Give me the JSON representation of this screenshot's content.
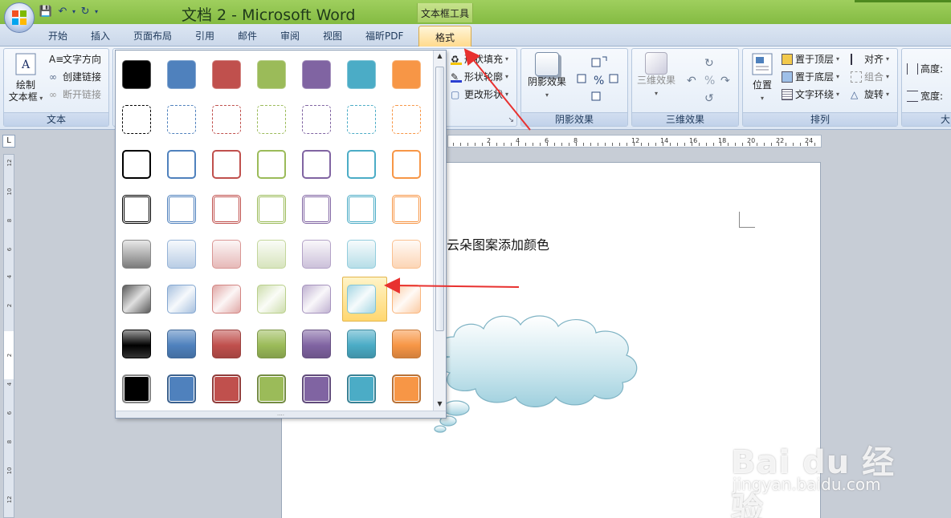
{
  "window": {
    "title": "文档 2 - Microsoft Word",
    "context_tab_group": "文本框工具"
  },
  "tabs": [
    {
      "label": "开始"
    },
    {
      "label": "插入"
    },
    {
      "label": "页面布局"
    },
    {
      "label": "引用"
    },
    {
      "label": "邮件"
    },
    {
      "label": "审阅"
    },
    {
      "label": "视图"
    },
    {
      "label": "福昕PDF"
    },
    {
      "label": "格式",
      "active": true
    }
  ],
  "ribbon": {
    "text_group": {
      "label": "文本",
      "draw_textbox_line1": "绘制",
      "draw_textbox_line2": "文本框",
      "text_direction": "文字方向",
      "create_link": "创建链接",
      "break_link": "断开链接"
    },
    "styles_group": {
      "shape_fill": "形状填充",
      "shape_outline": "形状轮廓",
      "change_shape": "更改形状"
    },
    "shadow_group": {
      "label": "阴影效果",
      "shadow_button": "阴影效果"
    },
    "threed_group": {
      "label": "三维效果",
      "threed_button": "三维效果"
    },
    "arrange_group": {
      "label": "排列",
      "position": "位置",
      "bring_front": "置于顶层",
      "send_back": "置于底层",
      "text_wrap": "文字环绕",
      "align": "对齐",
      "group": "组合",
      "rotate": "旋转"
    },
    "size_group": {
      "label": "大",
      "height": "高度:",
      "width": "宽度:"
    }
  },
  "document": {
    "body_text": "云朵图案添加颜色"
  },
  "ruler": {
    "horizontal_numbers": [
      "2",
      "4",
      "6",
      "8",
      "12",
      "14",
      "16",
      "18",
      "20",
      "22",
      "24"
    ],
    "vertical_numbers": [
      "12",
      "10",
      "8",
      "6",
      "4",
      "2",
      "2",
      "4",
      "6",
      "8",
      "10",
      "12"
    ]
  },
  "gallery": {
    "palette": [
      "#000000",
      "#4f81bd",
      "#c0504d",
      "#9bbb59",
      "#8064a2",
      "#4bacc6",
      "#f79646"
    ],
    "rows": [
      "solid-fill",
      "dashed-outline",
      "outline",
      "double-outline",
      "light-gradient",
      "diagonal-gradient",
      "glossy",
      "solid-bordered"
    ],
    "selected": {
      "row": 6,
      "column": 6
    }
  },
  "watermark": {
    "brand": "Bai du 经验",
    "url": "jingyan.baidu.com"
  }
}
